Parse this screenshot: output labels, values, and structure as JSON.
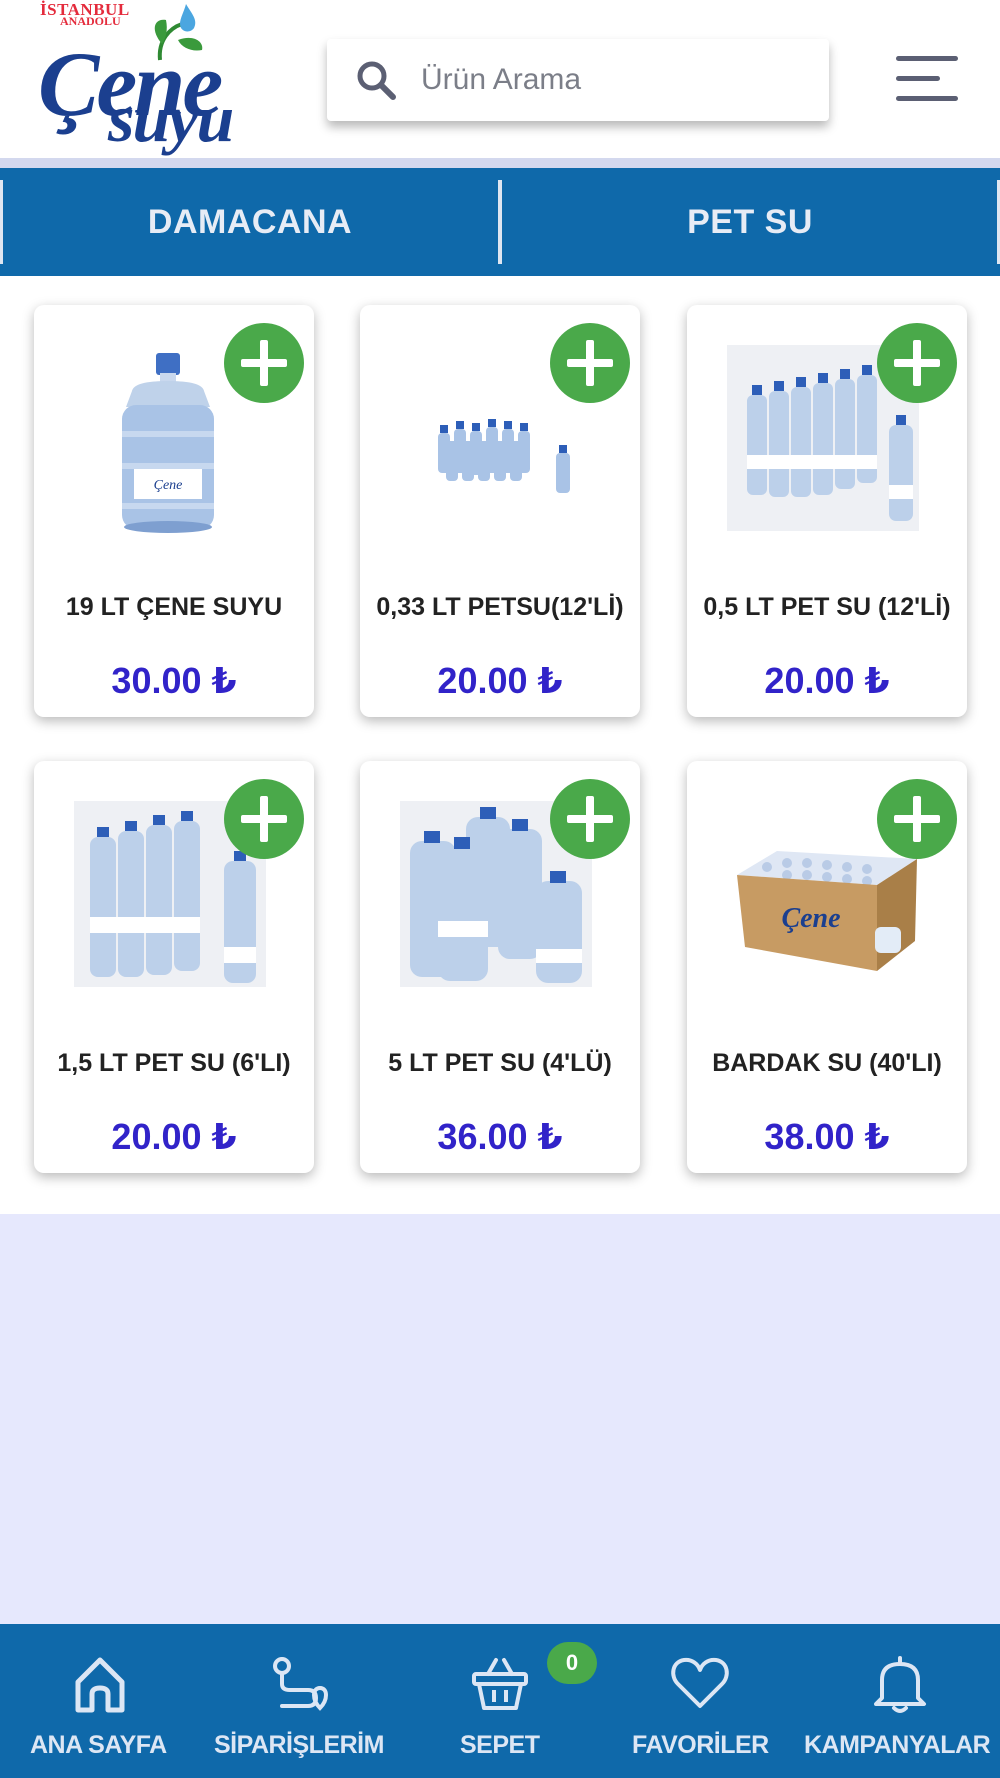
{
  "header": {
    "logo": {
      "line1": "İSTANBUL",
      "line2": "ANADOLU",
      "brand_top": "Çene",
      "brand_bottom": "suyu"
    },
    "search": {
      "placeholder": "Ürün Arama"
    }
  },
  "categories": [
    {
      "label": "DAMACANA"
    },
    {
      "label": "PET SU"
    }
  ],
  "products": [
    {
      "name": "19 LT ÇENE SUYU",
      "price": "30.00 ₺",
      "image": "water-jug-19lt"
    },
    {
      "name": "0,33 LT PETSU(12'Lİ)",
      "price": "20.00 ₺",
      "image": "small-bottle-pack"
    },
    {
      "name": "0,5 LT PET SU (12'Lİ)",
      "price": "20.00 ₺",
      "image": "bottle-pack-12"
    },
    {
      "name": "1,5 LT PET SU (6'LI)",
      "price": "20.00 ₺",
      "image": "bottle-pack-6"
    },
    {
      "name": "5 LT PET SU (4'LÜ)",
      "price": "36.00 ₺",
      "image": "bottle-pack-4"
    },
    {
      "name": "BARDAK SU (40'LI)",
      "price": "38.00 ₺",
      "image": "cup-water-box"
    }
  ],
  "bottom_nav": {
    "items": [
      {
        "label": "ANA SAYFA",
        "icon": "home-icon"
      },
      {
        "label": "SİPARİŞLERİM",
        "icon": "route-icon"
      },
      {
        "label": "SEPET",
        "icon": "basket-icon"
      },
      {
        "label": "FAVORİLER",
        "icon": "heart-icon"
      },
      {
        "label": "KAMPANYALAR",
        "icon": "bell-icon"
      }
    ],
    "cart_count": "0"
  },
  "colors": {
    "primary": "#0f69aa",
    "accent_green": "#4aa94a",
    "price": "#3123c9",
    "background": "#e6e8fd"
  }
}
